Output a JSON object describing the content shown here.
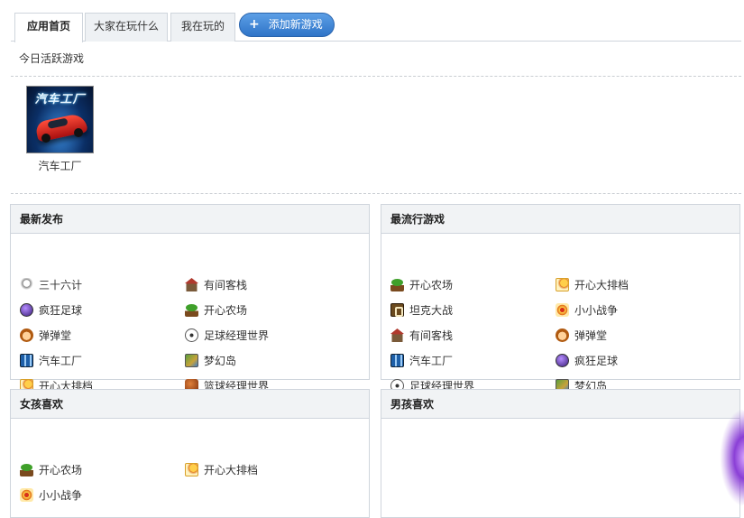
{
  "tabs": [
    {
      "label": "应用首页",
      "active": true
    },
    {
      "label": "大家在玩什么",
      "active": false
    },
    {
      "label": "我在玩的",
      "active": false
    }
  ],
  "add_button": {
    "label": "添加新游戏",
    "icon": "plus-icon"
  },
  "today_active": {
    "title": "今日活跃游戏",
    "items": [
      {
        "name": "汽车工厂",
        "icon": "car-factory-thumbnail"
      }
    ]
  },
  "panels": {
    "newest": {
      "title": "最新发布",
      "games": [
        {
          "name": "三十六计",
          "icon": "strategy-icon"
        },
        {
          "name": "有间客栈",
          "icon": "inn-icon"
        },
        {
          "name": "疯狂足球",
          "icon": "crazy-soccer-icon"
        },
        {
          "name": "开心农场",
          "icon": "farm-sprout-icon"
        },
        {
          "name": "弹弹堂",
          "icon": "ddtank-face-icon"
        },
        {
          "name": "足球经理世界",
          "icon": "soccer-ball-icon"
        },
        {
          "name": "汽车工厂",
          "icon": "car-factory-icon"
        },
        {
          "name": "梦幻岛",
          "icon": "dream-island-icon"
        },
        {
          "name": "开心大排档",
          "icon": "food-stall-icon"
        },
        {
          "name": "篮球经理世界",
          "icon": "basketball-icon"
        }
      ]
    },
    "popular": {
      "title": "最流行游戏",
      "games": [
        {
          "name": "开心农场",
          "icon": "farm-sprout-icon"
        },
        {
          "name": "开心大排档",
          "icon": "food-stall-icon"
        },
        {
          "name": "坦克大战",
          "icon": "tank-icon"
        },
        {
          "name": "小小战争",
          "icon": "little-war-icon"
        },
        {
          "name": "有间客栈",
          "icon": "inn-icon"
        },
        {
          "name": "弹弹堂",
          "icon": "ddtank-face-icon"
        },
        {
          "name": "汽车工厂",
          "icon": "car-factory-icon"
        },
        {
          "name": "疯狂足球",
          "icon": "crazy-soccer-icon"
        },
        {
          "name": "足球经理世界",
          "icon": "soccer-ball-icon"
        },
        {
          "name": "梦幻岛",
          "icon": "dream-island-icon"
        }
      ]
    },
    "girls": {
      "title": "女孩喜欢",
      "games": [
        {
          "name": "开心农场",
          "icon": "farm-sprout-icon"
        },
        {
          "name": "开心大排档",
          "icon": "food-stall-icon"
        },
        {
          "name": "小小战争",
          "icon": "little-war-icon"
        }
      ]
    },
    "boys": {
      "title": "男孩喜欢",
      "games": []
    }
  }
}
